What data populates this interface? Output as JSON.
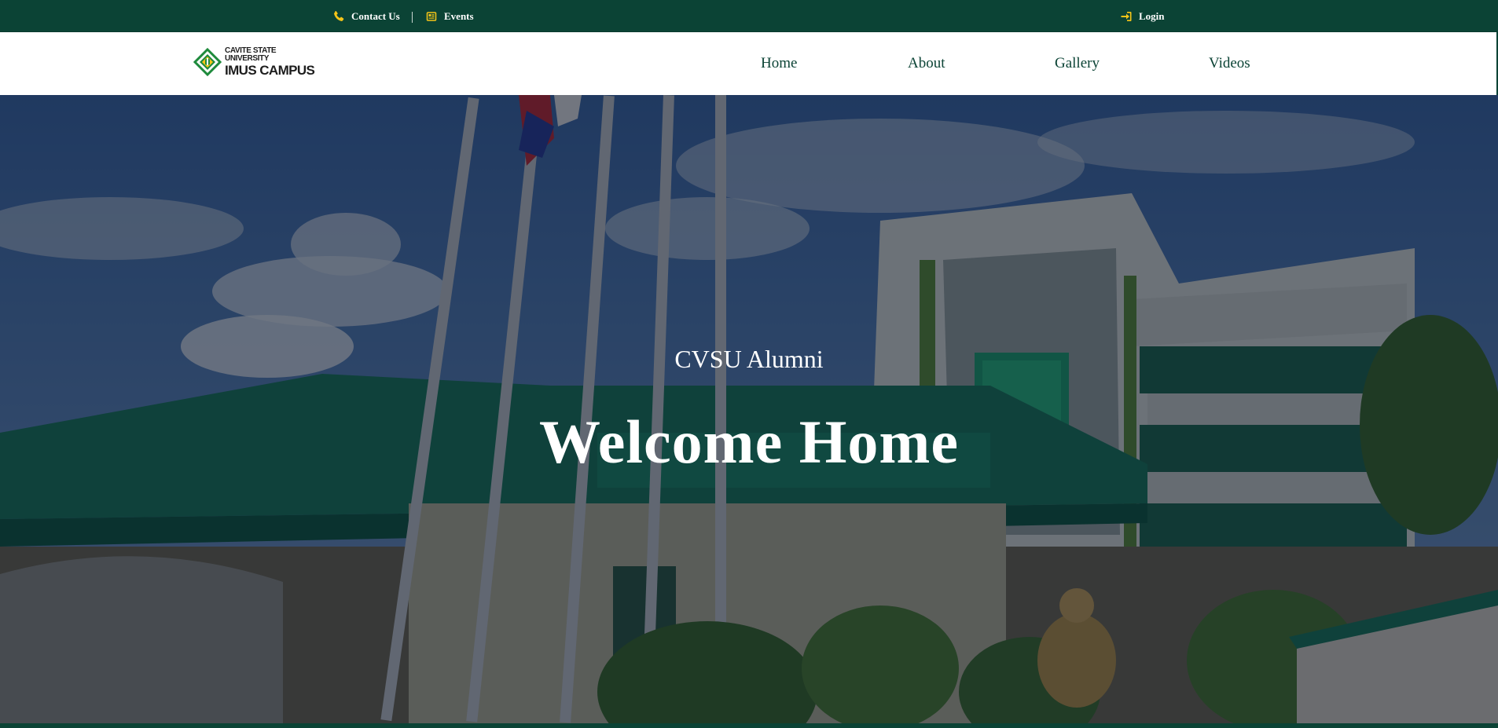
{
  "topbar": {
    "contact_label": "Contact Us",
    "events_label": "Events",
    "login_label": "Login",
    "icon_color": "#f5c518",
    "background": "#0b4335"
  },
  "logo": {
    "line1": "CAVITE STATE UNIVERSITY",
    "line2": "IMUS CAMPUS"
  },
  "nav": {
    "items": [
      {
        "label": "Home"
      },
      {
        "label": "About"
      },
      {
        "label": "Gallery"
      },
      {
        "label": "Videos"
      }
    ]
  },
  "hero": {
    "subtitle": "CVSU Alumni",
    "title": "Welcome Home"
  },
  "icons": {
    "contact": "phone-icon",
    "events": "newspaper-icon",
    "login": "sign-in-icon"
  }
}
